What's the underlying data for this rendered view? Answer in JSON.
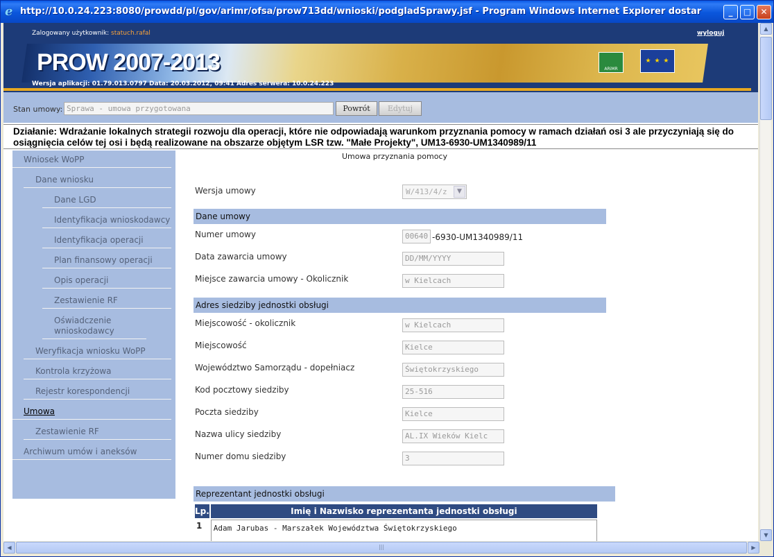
{
  "window": {
    "title": "http://10.0.24.223:8080/prowdd/pl/gov/arimr/ofsa/prow713dd/wnioski/podgladSprawy.jsf - Program Windows Internet Explorer dostar"
  },
  "header": {
    "user_label": "Zalogowany użytkownik:",
    "user_name": "statuch.rafal",
    "logout": "wyloguj",
    "banner_title": "PROW 2007-2013",
    "arimr_logo_text": "ARiMR",
    "version_info": "Wersja aplikacji: 01.79.013.0797 Data: 20.03.2012, 09:41 Adres serwera: 10.0.24.223"
  },
  "state_bar": {
    "label": "Stan umowy:",
    "value": "Sprawa - umowa przygotowana",
    "back_button": "Powrót",
    "edit_button": "Edytuj"
  },
  "action_line": "Działanie: Wdrażanie lokalnych strategii rozwoju dla operacji, które nie odpowiadają warunkom przyznania pomocy w ramach działań osi 3 ale przyczyniają się do osiągnięcia celów tej osi i będą realizowane na obszarze objętym LSR tzw. \"Małe Projekty\", UM13-6930-UM1340989/11",
  "nav": {
    "items": [
      {
        "label": "Wniosek WoPP"
      },
      {
        "label": "Dane wniosku"
      },
      {
        "label": "Dane LGD"
      },
      {
        "label": "Identyfikacja wnioskodawcy"
      },
      {
        "label": "Identyfikacja operacji"
      },
      {
        "label": "Plan finansowy operacji"
      },
      {
        "label": "Opis operacji"
      },
      {
        "label": "Zestawienie RF"
      },
      {
        "label": "Oświadczenie wnioskodawcy"
      },
      {
        "label": "Weryfikacja wniosku WoPP"
      },
      {
        "label": "Kontrola krzyżowa"
      },
      {
        "label": "Rejestr korespondencji"
      },
      {
        "label": "Umowa"
      },
      {
        "label": "Zestawienie RF"
      },
      {
        "label": "Archiwum umów i aneksów"
      }
    ]
  },
  "main": {
    "page_title": "Umowa przyznania pomocy",
    "version_label": "Wersja umowy",
    "version_value": "W/413/4/z",
    "section_contract": "Dane umowy",
    "contract_number_label": "Numer umowy",
    "contract_number_prefix": "00640",
    "contract_number_suffix": "-6930-UM1340989/11",
    "date_label": "Data zawarcia umowy",
    "date_placeholder": "DD/MM/YYYY",
    "place_label": "Miejsce zawarcia umowy - Okolicznik",
    "place_value": "w Kielcach",
    "section_address": "Adres siedziby jednostki obsługi",
    "address_fields": [
      {
        "label": "Miejscowość - okolicznik",
        "value": "w Kielcach"
      },
      {
        "label": "Miejscowość",
        "value": "Kielce"
      },
      {
        "label": "Województwo Samorządu - dopełniacz",
        "value": "Świętokrzyskiego"
      },
      {
        "label": "Kod pocztowy siedziby",
        "value": "25-516"
      },
      {
        "label": "Poczta siedziby",
        "value": "Kielce"
      },
      {
        "label": "Nazwa ulicy siedziby",
        "value": "AL.IX Wieków Kielc"
      },
      {
        "label": "Numer domu siedziby",
        "value": "3"
      }
    ],
    "section_rep": "Reprezentant jednostki obsługi",
    "rep_table": {
      "headers": [
        "Lp.",
        "Imię i Nazwisko reprezentanta jednostki obsługi"
      ],
      "rows": [
        {
          "lp": "1",
          "name": "Adam Jarubas - Marszałek Województwa Świętokrzyskiego"
        }
      ]
    }
  }
}
